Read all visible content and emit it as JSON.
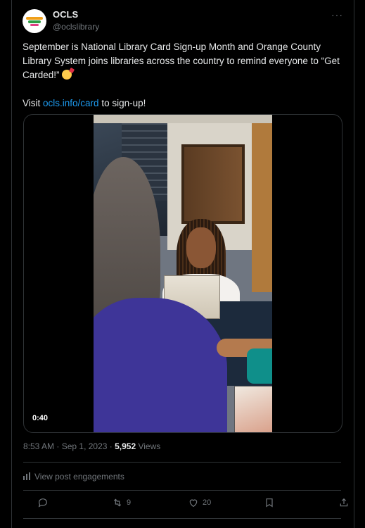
{
  "account": {
    "display_name": "OCLS",
    "handle": "@oclslibrary",
    "avatar_icon": "ocls-logo-icon"
  },
  "menu": {
    "more_label": "···"
  },
  "tweet": {
    "line1": "September is National Library Card Sign-up Month and Orange County Library System joins libraries across the country to remind everyone to “Get Carded!” ",
    "emoji_icon": "party-face-emoji-icon",
    "visit_prefix": "Visit ",
    "link_text": "ocls.info/card",
    "visit_suffix": " to sign-up!"
  },
  "media": {
    "duration": "0:40"
  },
  "meta": {
    "time": "8:53 AM",
    "separator": " · ",
    "date": "Sep 1, 2023",
    "dot": " · ",
    "views_count": "5,952",
    "views_label": " Views"
  },
  "engagements": {
    "label": "View post engagements"
  },
  "actions": {
    "reply_count": "",
    "retweet_count": "9",
    "like_count": "20"
  },
  "colors": {
    "background": "#000000",
    "text": "#e7e9ea",
    "secondary": "#71767b",
    "link": "#1d9bf0",
    "border": "#2f3336"
  }
}
